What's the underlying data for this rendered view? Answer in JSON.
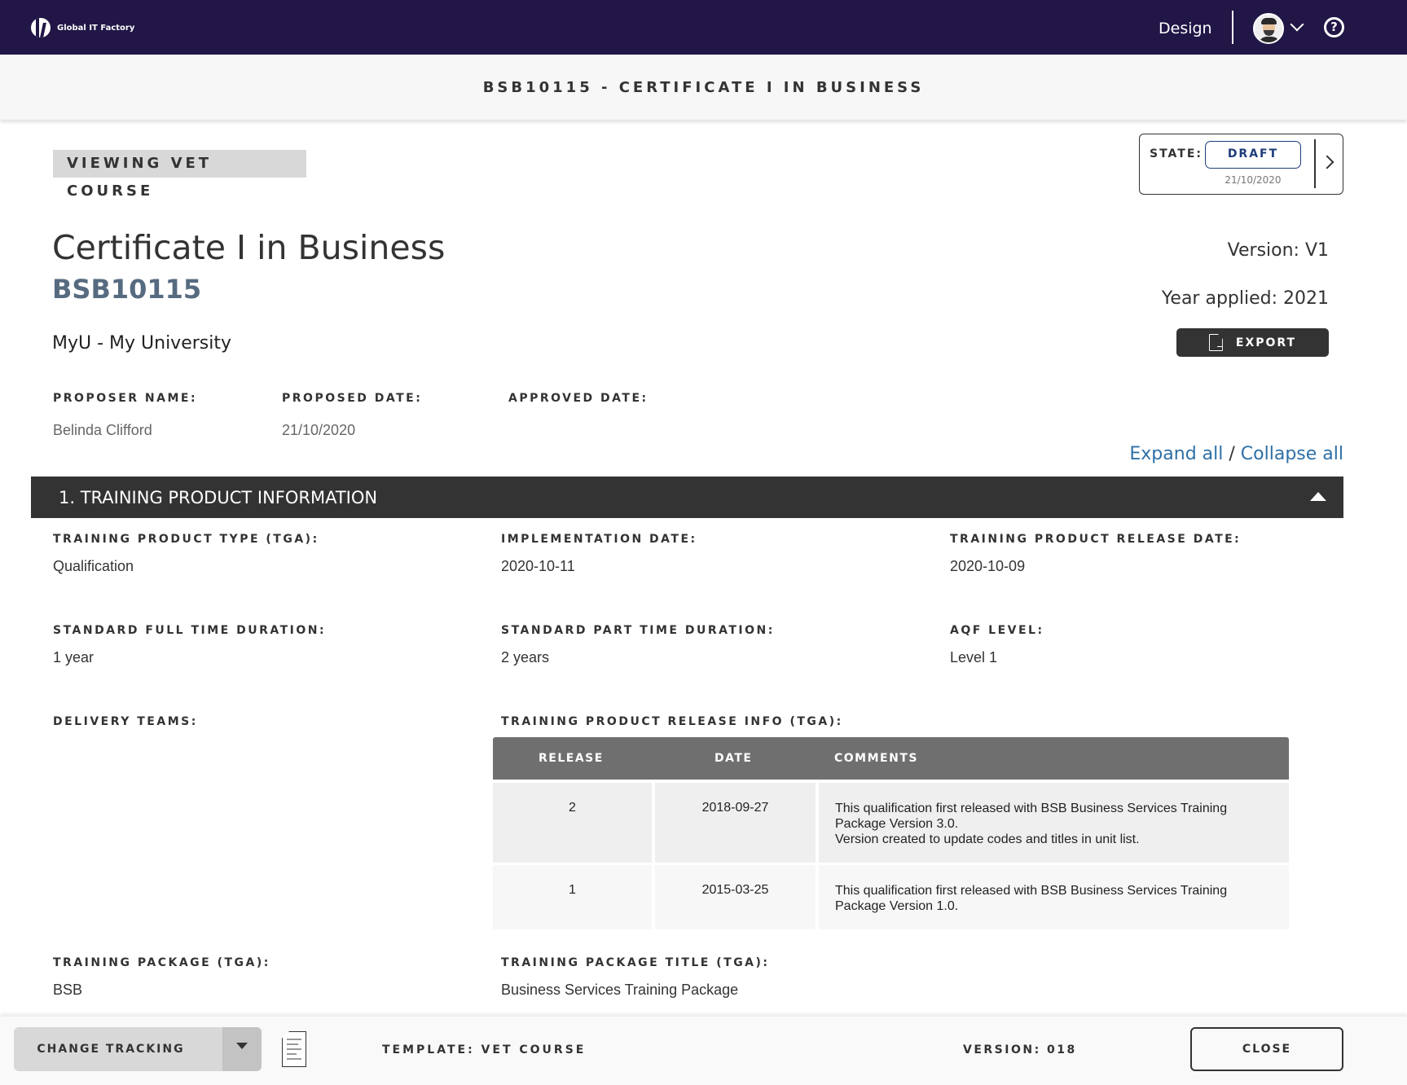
{
  "app": {
    "brand": "Global IT Factory",
    "role": "Design",
    "help_icon": "question-circle-icon",
    "avatar_icon": "user-avatar-icon"
  },
  "titlebar": {
    "title": "BSB10115 - CERTIFICATE I IN BUSINESS"
  },
  "viewing_badge": "VIEWING VET COURSE",
  "state": {
    "label": "STATE:",
    "value": "DRAFT",
    "date": "21/10/2020",
    "colors": {
      "pill": "#1e3c7a"
    }
  },
  "course": {
    "title": "Certificate I in Business",
    "code": "BSB10115",
    "organisation": "MyU - My University",
    "version": "Version: V1",
    "year_applied": "Year applied: 2021",
    "export_label": "EXPORT"
  },
  "meta": {
    "proposer_label": "PROPOSER NAME:",
    "proposer_value": "Belinda Clifford",
    "proposed_label": "PROPOSED DATE:",
    "proposed_value": "21/10/2020",
    "approved_label": "APPROVED DATE:",
    "approved_value": ""
  },
  "expand_all": "Expand all",
  "separator": "/",
  "collapse_all": "Collapse all",
  "section": {
    "title": "1. TRAINING PRODUCT INFORMATION",
    "fields": {
      "product_type_label": "TRAINING PRODUCT TYPE (TGA):",
      "product_type_value": "Qualification",
      "implementation_label": "IMPLEMENTATION DATE:",
      "implementation_value": "2020-10-11",
      "release_date_label": "TRAINING PRODUCT RELEASE DATE:",
      "release_date_value": "2020-10-09",
      "full_time_label": "STANDARD FULL TIME DURATION:",
      "full_time_value": "1 year",
      "part_time_label": "STANDARD PART TIME DURATION:",
      "part_time_value": "2 years",
      "aqf_label": "AQF LEVEL:",
      "aqf_value": "Level 1",
      "delivery_teams_label": "DELIVERY TEAMS:",
      "release_info_label": "TRAINING PRODUCT RELEASE INFO (TGA):",
      "package_label": "TRAINING PACKAGE (TGA):",
      "package_value": "BSB",
      "package_title_label": "TRAINING PACKAGE TITLE (TGA):",
      "package_title_value": "Business Services Training Package"
    },
    "release_table": {
      "headers": [
        "RELEASE",
        "DATE",
        "COMMENTS"
      ],
      "rows": [
        {
          "release": "2",
          "date": "2018-09-27",
          "comments": [
            "This qualification first released with BSB Business Services Training Package Version 3.0.",
            "Version created to update codes and titles in unit list."
          ]
        },
        {
          "release": "1",
          "date": "2015-03-25",
          "comments": [
            "This qualification first released with BSB Business Services Training Package Version 1.0."
          ]
        }
      ]
    }
  },
  "footer": {
    "change_tracking": "CHANGE TRACKING",
    "template": "TEMPLATE: VET COURSE",
    "version": "VERSION: 018",
    "close": "CLOSE"
  }
}
